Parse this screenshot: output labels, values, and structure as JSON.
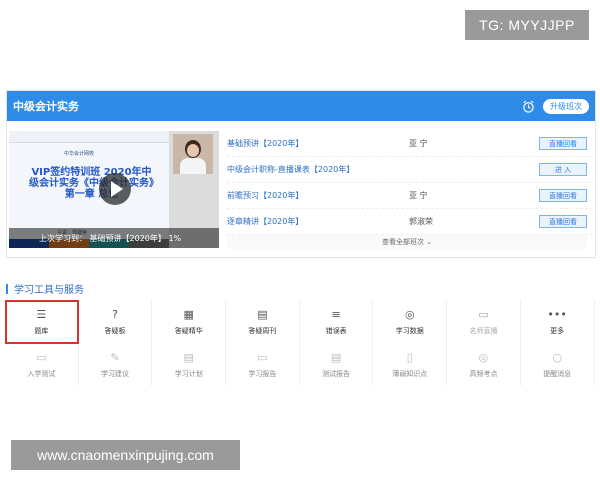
{
  "watermark_tg": "TG: MYYJJPP",
  "watermark_url": "www.cnaomenxinpujing.com",
  "panel": {
    "title": "中级会计实务",
    "upgrade_label": "升级班次",
    "alarm_icon": "alarm-clock-icon"
  },
  "video": {
    "slide_logo": "中华会计网校",
    "slide_title": "VIP签约特训班 2020年中级会计实务《中级会计实务》第一章 总论",
    "slide_chapter": "第一章 总论",
    "slide_presenter": "主讲：郭建荣",
    "last_study": "上次学习到：  基础预讲【2020年】  1%"
  },
  "courses": [
    {
      "name": "基础预讲【2020年】",
      "teacher": "亚  宁",
      "action": "直播回看"
    },
    {
      "name": "中级会计职称-直播课表【2020年】",
      "teacher": "",
      "action": "进 入"
    },
    {
      "name": "前瞻预习【2020年】",
      "teacher": "亚  宁",
      "action": "直播回看"
    },
    {
      "name": "逐章精讲【2020年】",
      "teacher": "郭淑荣",
      "action": "直播回看"
    }
  ],
  "view_all": "查看全部班次 ⌄",
  "tools_title": "学习工具与服务",
  "tools_row1": [
    {
      "label": "题库",
      "icon": "☰"
    },
    {
      "label": "答疑板",
      "icon": "?"
    },
    {
      "label": "答疑精华",
      "icon": "▦"
    },
    {
      "label": "答疑周刊",
      "icon": "▤"
    },
    {
      "label": "错误表",
      "icon": "≡"
    },
    {
      "label": "学习数据",
      "icon": "◎"
    },
    {
      "label": "名师直播",
      "icon": "▭"
    },
    {
      "label": "更多",
      "icon": "•••"
    }
  ],
  "tools_row2": [
    {
      "label": "入学测试",
      "icon": "▭"
    },
    {
      "label": "学习建议",
      "icon": "✎"
    },
    {
      "label": "学习计划",
      "icon": "▤"
    },
    {
      "label": "学习报告",
      "icon": "▭"
    },
    {
      "label": "测试报告",
      "icon": "▤"
    },
    {
      "label": "薄弱知识点",
      "icon": "▯"
    },
    {
      "label": "高频考点",
      "icon": "◎"
    },
    {
      "label": "提醒消息",
      "icon": "○"
    }
  ]
}
